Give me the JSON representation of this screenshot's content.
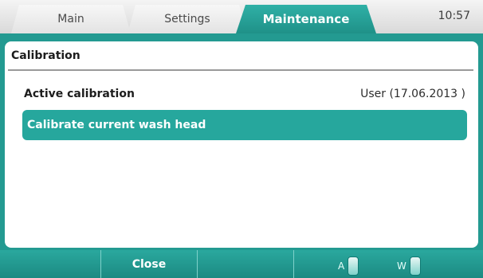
{
  "tabs": {
    "main": "Main",
    "settings": "Settings",
    "maintenance": "Maintenance",
    "time": "10:57"
  },
  "panel": {
    "title": "Calibration",
    "active_calibration_label": "Active calibration",
    "active_calibration_value": "User (17.06.2013 )",
    "calibrate_button": "Calibrate current wash head"
  },
  "softkeys": {
    "close": "Close"
  },
  "status": {
    "a_label": "A",
    "w_label": "W"
  },
  "colors": {
    "accent": "#26a79d"
  }
}
